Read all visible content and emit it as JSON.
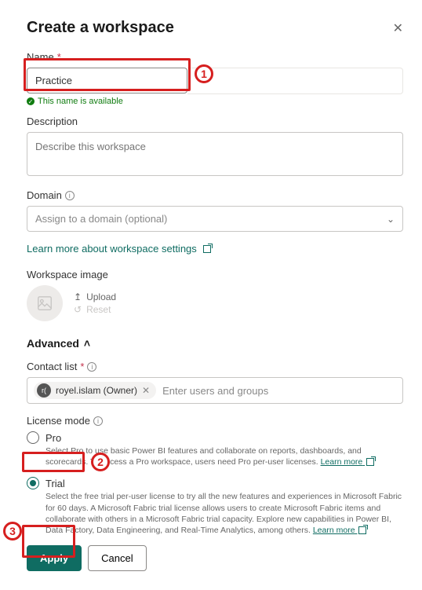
{
  "header": {
    "title": "Create a workspace"
  },
  "name": {
    "label": "Name",
    "value": "Practice",
    "status": "This name is available"
  },
  "description": {
    "label": "Description",
    "placeholder": "Describe this workspace"
  },
  "domain": {
    "label": "Domain",
    "placeholder": "Assign to a domain (optional)"
  },
  "settings_link": "Learn more about workspace settings",
  "image": {
    "label": "Workspace image",
    "upload": "Upload",
    "reset": "Reset"
  },
  "advanced": {
    "label": "Advanced"
  },
  "contact": {
    "label": "Contact list",
    "chip_initial": "r(",
    "chip_text": "royel.islam (Owner)",
    "placeholder": "Enter users and groups"
  },
  "license": {
    "label": "License mode",
    "pro": {
      "label": "Pro",
      "desc": "Select Pro to use basic Power BI features and collaborate on reports, dashboards, and scorecards. To access a Pro workspace, users need Pro per-user licenses.",
      "learn": "Learn more"
    },
    "trial": {
      "label": "Trial",
      "desc": "Select the free trial per-user license to try all the new features and experiences in Microsoft Fabric for 60 days. A Microsoft Fabric trial license allows users to create Microsoft Fabric items and collaborate with others in a Microsoft Fabric trial capacity. Explore new capabilities in Power BI, Data Factory, Data Engineering, and Real-Time Analytics, among others.",
      "learn": "Learn more"
    }
  },
  "buttons": {
    "apply": "Apply",
    "cancel": "Cancel"
  },
  "callouts": {
    "n1": "1",
    "n2": "2",
    "n3": "3"
  }
}
